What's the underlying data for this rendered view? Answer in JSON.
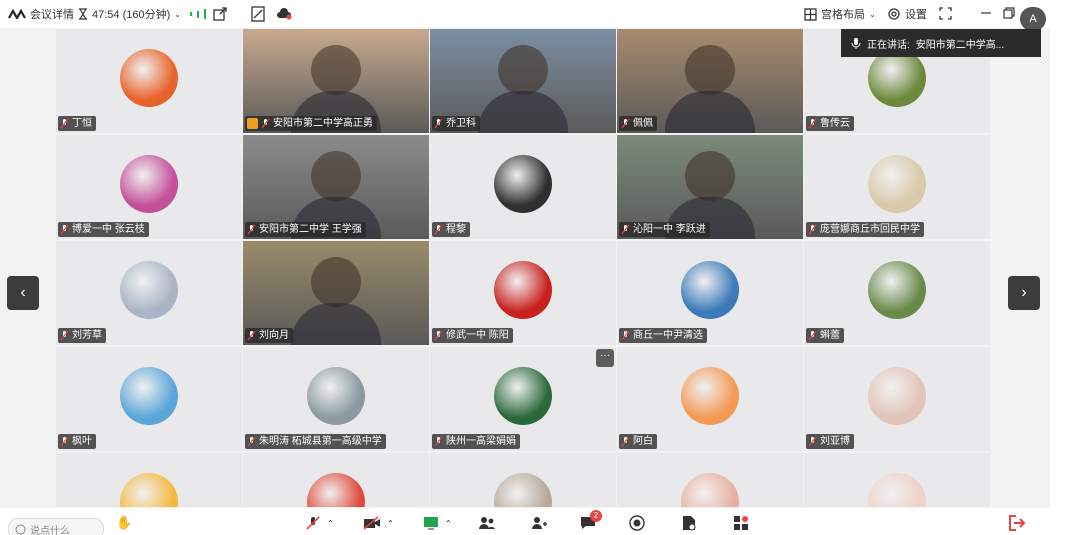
{
  "topbar": {
    "meeting_details": "会议详情",
    "timer": "47:54 (160分钟)",
    "layout_label": "宫格布局",
    "settings_label": "设置"
  },
  "speaking": {
    "label": "正在讲话:",
    "name": "安阳市第二中学高..."
  },
  "colors": {
    "accent": "#46c46a",
    "end_call": "#e8453c"
  },
  "tiles": [
    {
      "name": "丁恒",
      "kind": "avatar",
      "color": "#e8632a"
    },
    {
      "name": "安阳市第二中学高正勇",
      "kind": "video",
      "color": "#c8a98e",
      "active": true,
      "host": true
    },
    {
      "name": "乔卫科",
      "kind": "video",
      "color": "#7c8fa3"
    },
    {
      "name": "佩佩",
      "kind": "video",
      "color": "#a88b6e"
    },
    {
      "name": "鲁传云",
      "kind": "avatar",
      "color": "#6d8a3c"
    },
    {
      "name": "博爱一中 张云枝",
      "kind": "avatar",
      "color": "#c44f9b"
    },
    {
      "name": "安阳市第二中学 王学强",
      "kind": "video",
      "color": "#8b8b8b"
    },
    {
      "name": "程黎",
      "kind": "avatar",
      "color": "#2f2f2f"
    },
    {
      "name": "沁阳一中 李跃进",
      "kind": "video",
      "color": "#7a8a7a"
    },
    {
      "name": "庞营娜商丘市回民中学",
      "kind": "avatar",
      "color": "#d8c9a8"
    },
    {
      "name": "刘芳草",
      "kind": "avatar",
      "color": "#a9b4c4"
    },
    {
      "name": "刘向月",
      "kind": "video",
      "color": "#9a8a6a"
    },
    {
      "name": "修武一中 陈阳",
      "kind": "avatar",
      "color": "#c9221d"
    },
    {
      "name": "商丘一中尹清选",
      "kind": "avatar",
      "color": "#3c7ab8"
    },
    {
      "name": "蝌蕾",
      "kind": "avatar",
      "color": "#6a8a4a"
    },
    {
      "name": "枫叶",
      "kind": "avatar",
      "color": "#5aa6d8"
    },
    {
      "name": "朱明涛 柘城县第一高级中学",
      "kind": "avatar",
      "color": "#8a9aa0"
    },
    {
      "name": "陕州一高梁娟娟",
      "kind": "avatar",
      "color": "#2a6a3a",
      "more": true
    },
    {
      "name": "阿白",
      "kind": "avatar",
      "color": "#f39a55"
    },
    {
      "name": "刘亚博",
      "kind": "avatar",
      "color": "#e2c4b8"
    },
    {
      "name": "",
      "kind": "avatar",
      "color": "#f5b83c"
    },
    {
      "name": "",
      "kind": "avatar",
      "color": "#e04a3a"
    },
    {
      "name": "",
      "kind": "avatar",
      "color": "#b8a898"
    },
    {
      "name": "",
      "kind": "avatar",
      "color": "#e8b0a0"
    },
    {
      "name": "",
      "kind": "avatar",
      "color": "#f0d0c8"
    }
  ],
  "bottombar": {
    "chat_placeholder": "说点什么",
    "chat_badge": "2"
  }
}
